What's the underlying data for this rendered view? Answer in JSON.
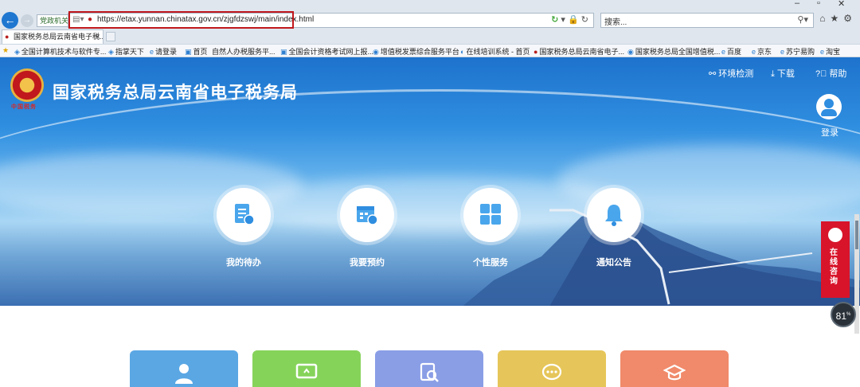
{
  "browser": {
    "compat_label": "党政机关",
    "url": "https://etax.yunnan.chinatax.gov.cn/zjgfdzswj/main/index.html",
    "search_placeholder": "搜索...",
    "tab_title": "国家税务总局云南省电子税..."
  },
  "favorites": [
    "全国计算机技术与软件专...",
    "指掌天下",
    "请登录",
    "首页",
    "自然人办税服务平...",
    "全国会计资格考试网上报...",
    "增值税发票综合服务平台",
    "在线培训系统 - 首页",
    "国家税务总局云南省电子...",
    "国家税务总局全国增值税...",
    "百度",
    "京东",
    "苏宁易购",
    "淘宝"
  ],
  "site": {
    "title": "国家税务总局云南省电子税务局",
    "logo_text": "中国税务",
    "links": {
      "env": "环境检测",
      "download": "下载",
      "help": "帮助"
    },
    "login": "登录"
  },
  "features": [
    {
      "label": "我的待办",
      "icon": "todo-list-icon"
    },
    {
      "label": "我要预约",
      "icon": "calendar-clock-icon"
    },
    {
      "label": "个性服务",
      "icon": "grid-icon"
    },
    {
      "label": "通知公告",
      "icon": "bell-icon"
    }
  ],
  "consult": {
    "label": "在线咨询"
  },
  "zoom": {
    "value": "81",
    "unit": "%"
  },
  "colors": {
    "accent": "#1e73cc",
    "consult": "#d8142a",
    "card_colors": [
      "#5aa7e4",
      "#86d35a",
      "#8a9ee6",
      "#e6c65a",
      "#f08a6a"
    ]
  }
}
